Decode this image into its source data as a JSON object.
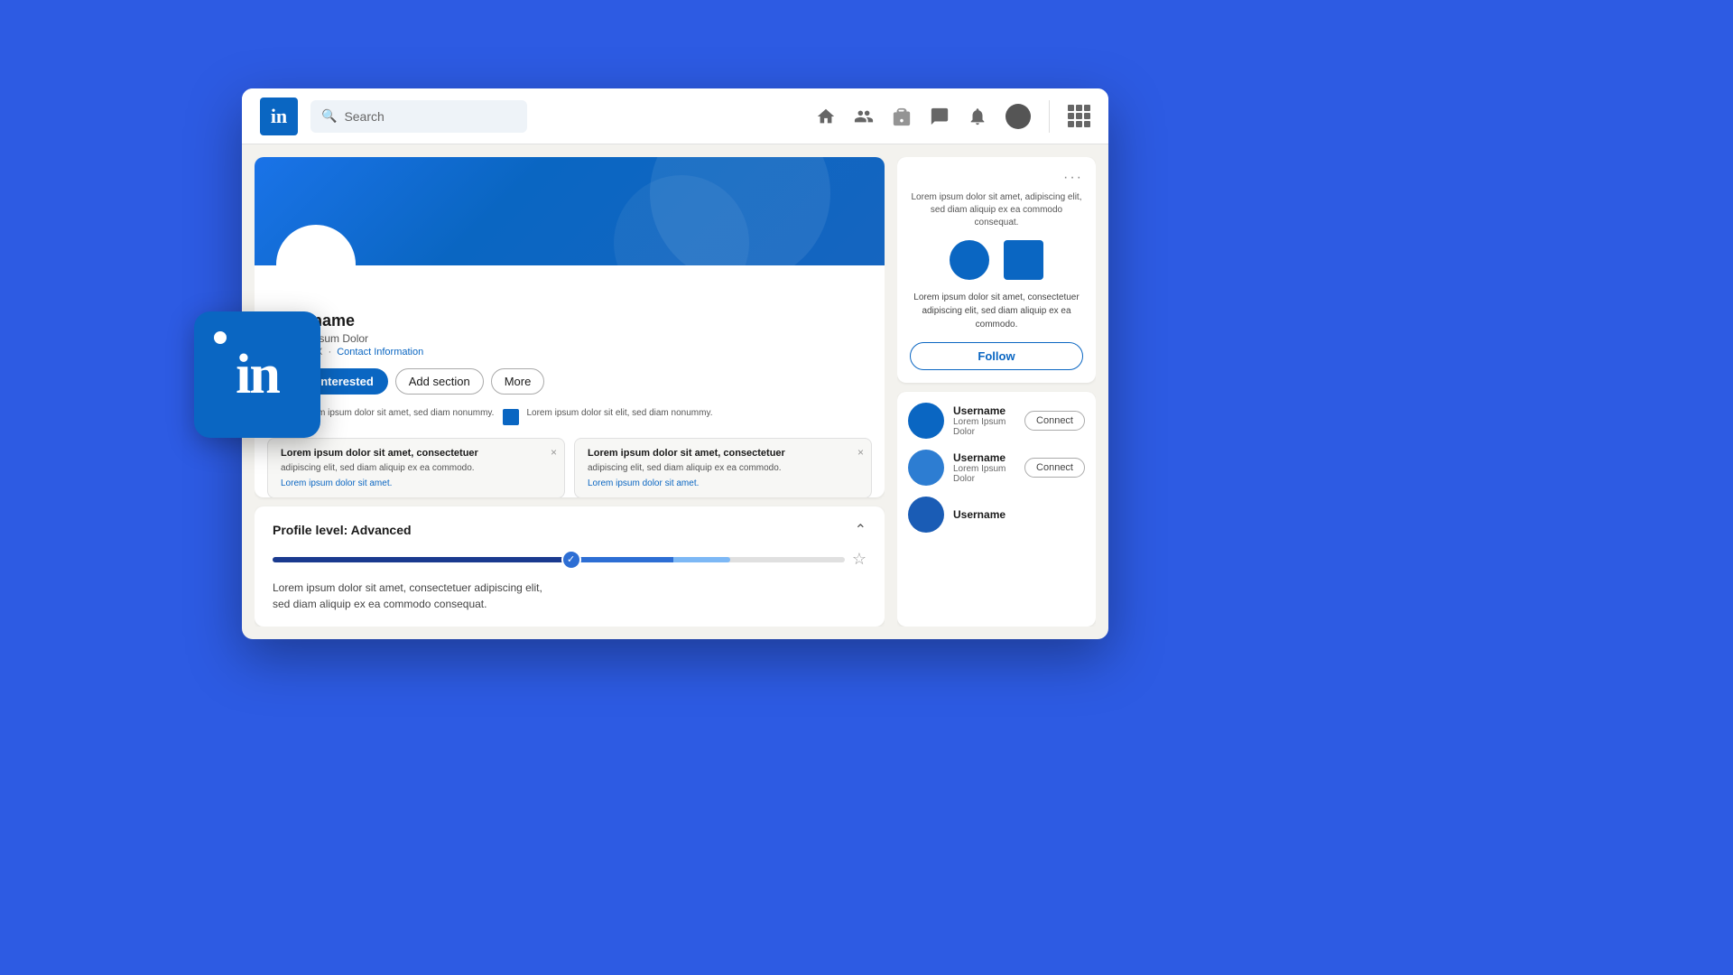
{
  "scene": {
    "background_color": "#2d5be3"
  },
  "navbar": {
    "logo_text": "in",
    "search_placeholder": "Search",
    "search_label": "Search",
    "icons": [
      "home",
      "people",
      "briefcase",
      "chat",
      "bell",
      "avatar",
      "grid"
    ]
  },
  "profile": {
    "username": "Username",
    "subtitle": "Lorem Ipsum Dolor",
    "location": "Cdmx, MX",
    "contact_link": "Contact Information",
    "btn_interested": "I am interested",
    "btn_add_section": "Add section",
    "btn_more": "More",
    "info_box1_text": "Lorem ipsum dolor sit amet,\nsed diam nonummy.",
    "info_box2_text": "Lorem ipsum dolor sit elit, sed\ndiam nonummy."
  },
  "notifications": {
    "card1": {
      "title": "Lorem ipsum dolor sit amet, consectetuer",
      "body": "adipiscing elit, sed diam aliquip ex ea commodo.",
      "link": "Lorem ipsum dolor sit amet.",
      "close": "×"
    },
    "card2": {
      "title": "Lorem ipsum dolor sit amet, consectetuer",
      "body": "adipiscing elit, sed diam aliquip ex ea commodo.",
      "link": "Lorem ipsum dolor sit amet.",
      "close": "×"
    }
  },
  "profile_level": {
    "title": "Profile level: Advanced",
    "progress_percent": 68,
    "description_line1": "Lorem ipsum dolor sit amet, consectetuer adipiscing elit,",
    "description_line2": "sed diam aliquip ex ea commodo consequat."
  },
  "sidebar": {
    "card1": {
      "dots": "···",
      "top_text": "Lorem ipsum dolor sit amet, adipiscing elit, sed diam aliquip ex ea commodo consequat.",
      "description": "Lorem ipsum dolor sit amet, consectetuer adipiscing elit, sed diam aliquip ex ea commodo.",
      "follow_btn": "Follow"
    },
    "people": [
      {
        "name": "Username",
        "subtitle": "Lorem Ipsum Dolor",
        "connect_btn": "Connect"
      },
      {
        "name": "Username",
        "subtitle": "Lorem Ipsum Dolor",
        "connect_btn": "Connect"
      },
      {
        "name": "Username",
        "subtitle": "",
        "connect_btn": ""
      }
    ]
  }
}
